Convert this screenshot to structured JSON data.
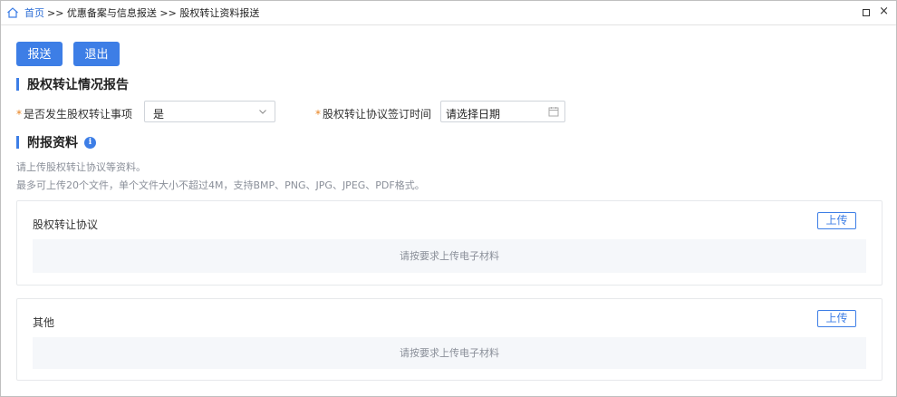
{
  "breadcrumb": {
    "home": "首页",
    "path": ">> 优惠备案与信息报送 >> 股权转让资料报送"
  },
  "window": {
    "restore_icon": "restore-icon",
    "close_icon": "close-icon",
    "close_glyph": "×"
  },
  "toolbar": {
    "report_label": "报送",
    "exit_label": "退出"
  },
  "section_report": {
    "title": "股权转让情况报告"
  },
  "form": {
    "occurred_label": "是否发生股权转让事项",
    "occurred_value": "是",
    "signing_label": "股权转让协议签订时间",
    "signing_placeholder": "请选择日期",
    "required_mark": "*"
  },
  "section_attach": {
    "title": "附报资料",
    "info_glyph": "i"
  },
  "hints": {
    "line1": "请上传股权转让协议等资料。",
    "line2": "最多可上传20个文件，单个文件大小不超过4M，支持BMP、PNG、JPG、JPEG、PDF格式。"
  },
  "panels": [
    {
      "title": "股权转让协议",
      "upload_label": "上传",
      "empty_text": "请按要求上传电子材料"
    },
    {
      "title": "其他",
      "upload_label": "上传",
      "empty_text": "请按要求上传电子材料"
    }
  ],
  "colors": {
    "primary": "#3d7ee6",
    "required": "#e8811d",
    "hint": "#8a8f99"
  }
}
